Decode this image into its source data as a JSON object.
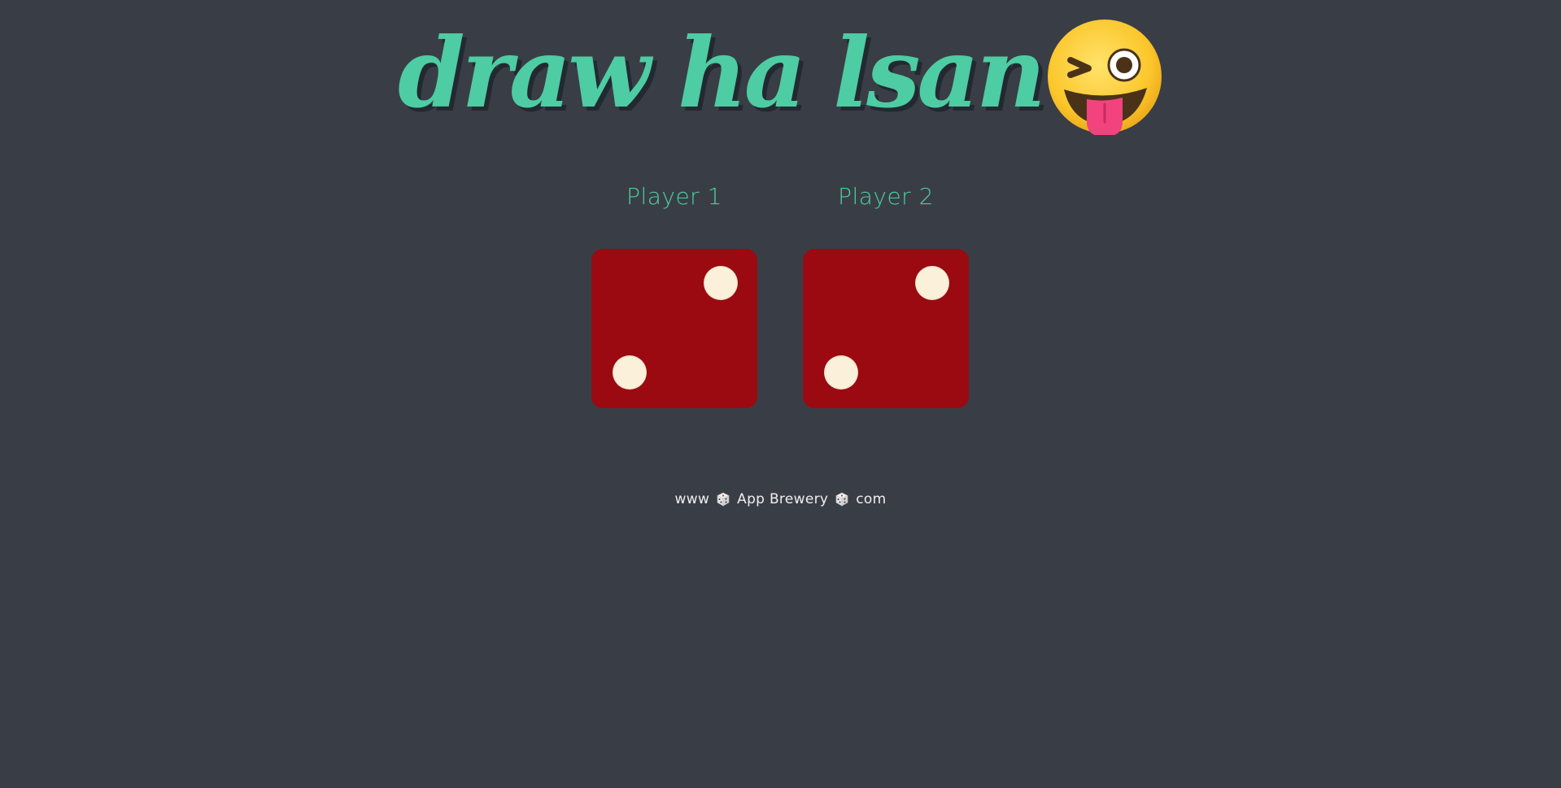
{
  "header": {
    "title": "draw ha lsan",
    "emoji_icon": "winking-face-with-tongue-icon",
    "title_color": "#4ecca3"
  },
  "players": [
    {
      "label": "Player 1",
      "die_value": 2
    },
    {
      "label": "Player 2",
      "die_value": 2
    }
  ],
  "footer": {
    "part1": "www",
    "part2": "App Brewery",
    "part3": "com",
    "separator_icon": "dice-icon"
  },
  "colors": {
    "background": "#393e46",
    "accent": "#4ecca3",
    "die": "#9a0a10",
    "pip": "#fbf0d9"
  }
}
